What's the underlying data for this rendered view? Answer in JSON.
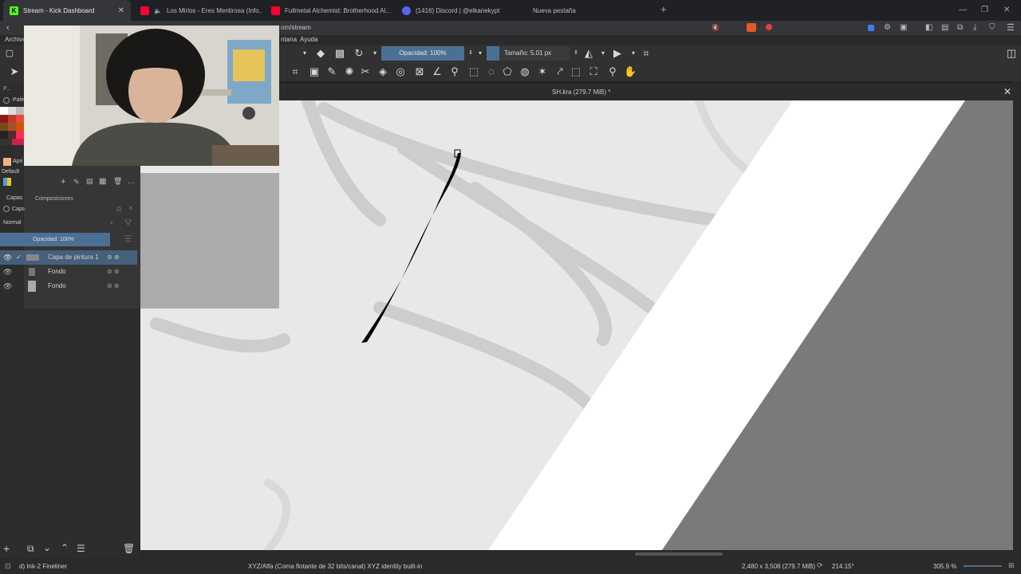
{
  "browser": {
    "tabs": [
      {
        "label": "Stream - Kick Dashboard",
        "favicon_color": "#53fc18",
        "active": true
      },
      {
        "label": "Los Mirlos - Eres Mentirosa (Info...",
        "favicon_color": "#ff0033",
        "active": false
      },
      {
        "label": "Fullmetal Alchemist: Brotherhood Al...",
        "favicon_color": "#ff0033",
        "active": false
      },
      {
        "label": "(1416) Discord | @elkanekypt",
        "favicon_color": "#5865f2",
        "active": false
      },
      {
        "label": "Nueva pestaña",
        "favicon_color": "",
        "active": false
      }
    ],
    "new_tab": "+",
    "address_fragment": "om/stream"
  },
  "menubar": {
    "items": [
      "Archivo",
      "ntana",
      "Ayuda"
    ]
  },
  "toolbar": {
    "opacity_label": "Opacidad: 100%",
    "size_label": "Tamaño: 5.01 px"
  },
  "document": {
    "tab_title": "SH.kra (279.7 MiB) *",
    "close": "✕"
  },
  "left_dock": {
    "palette_label": "Palet",
    "palette_name": "Apri",
    "default_label": "Default",
    "capas_tab": "Capas",
    "composiciones_tab": "Composiciones",
    "capas_label": "Capa",
    "blend_mode": "Normal",
    "opacity_label": "Opacidad:  100%",
    "layers": [
      {
        "name": "Capa de pintura 1",
        "selected": true
      },
      {
        "name": "Fondo",
        "selected": false
      },
      {
        "name": "Fondo",
        "selected": false
      }
    ],
    "panel_letter": "P..."
  },
  "statusbar": {
    "brush": "d) Ink-2 Fineliner",
    "colorspace": "XYZ/Alfa (Coma flotante de 32 bits/canal)  XYZ identity built-in",
    "dimensions": "2,480 x 3,508 (279.7 MiB)",
    "rotation": "214.15°",
    "zoom": "305.9 %"
  },
  "colors": {
    "accent": "#4c6f94",
    "canvas_bg": "#e8e8e8",
    "stripe_white": "#ffffff",
    "stripe_gray": "#7a7a7a"
  }
}
